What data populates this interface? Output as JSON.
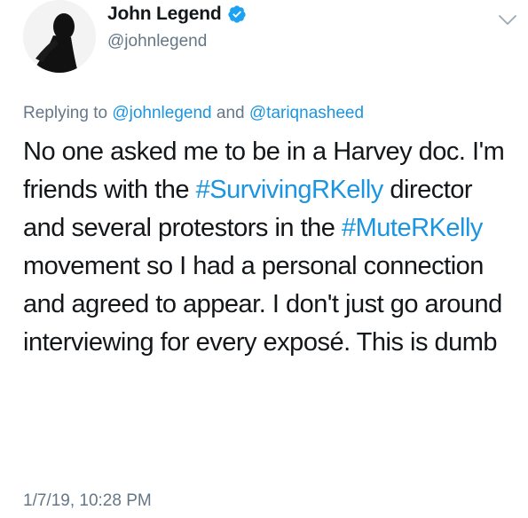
{
  "author": {
    "display_name": "John Legend",
    "handle": "@johnlegend",
    "verified": true,
    "avatar_icon": "profile-silhouette-icon"
  },
  "menu": {
    "icon": "chevron-down-icon"
  },
  "reply_context": {
    "prefix": "Replying to ",
    "mention_1": "@johnlegend",
    "conjunction": " and ",
    "mention_2": "@tariqnasheed"
  },
  "tweet": {
    "part_1": "No one asked me to be in a Harvey doc. I'm friends with the ",
    "hashtag_1": "#SurvivingRKelly",
    "part_2": " director and several protestors in the ",
    "hashtag_2": "#MuteRKelly",
    "part_3": " movement so I had a personal connection and agreed to appear. I don't just go around interviewing for every exposé. This is dumb"
  },
  "timestamp": "1/7/19, 10:28 PM",
  "colors": {
    "link": "#1b95e0",
    "secondary_text": "#657786",
    "primary_text": "#14171a",
    "verified_badge": "#1da1f2"
  }
}
